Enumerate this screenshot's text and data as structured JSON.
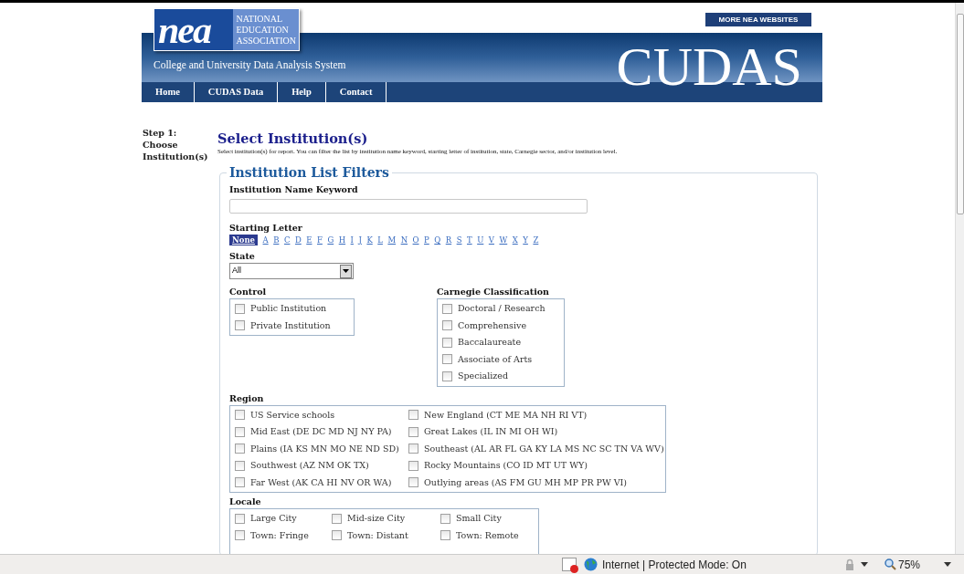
{
  "header": {
    "logo_mark": "nea",
    "logo_lines": [
      "NATIONAL",
      "EDUCATION",
      "ASSOCIATION"
    ],
    "more_link": "MORE NEA WEBSITES",
    "tagline": "College and University Data Analysis System",
    "brand": "CUDAS"
  },
  "nav": [
    {
      "label": "Home"
    },
    {
      "label": "CUDAS Data"
    },
    {
      "label": "Help"
    },
    {
      "label": "Contact"
    }
  ],
  "step": "Step 1: Choose Institution(s)",
  "title": "Select Institution(s)",
  "description": "Select institution(s) for report. You can filter the list by institution name keyword, starting letter of institution, state, Carnegie sector, and/or institution level.",
  "filters": {
    "legend": "Institution List Filters",
    "keyword": {
      "label": "Institution Name Keyword"
    },
    "starting_letter": {
      "label": "Starting Letter",
      "letters": [
        {
          "label": "None",
          "selected": true
        },
        {
          "label": "A",
          "selected": false
        },
        {
          "label": "B",
          "selected": false
        },
        {
          "label": "C",
          "selected": false
        },
        {
          "label": "D",
          "selected": false
        },
        {
          "label": "E",
          "selected": false
        },
        {
          "label": "F",
          "selected": false
        },
        {
          "label": "G",
          "selected": false
        },
        {
          "label": "H",
          "selected": false
        },
        {
          "label": "I",
          "selected": false
        },
        {
          "label": "J",
          "selected": false
        },
        {
          "label": "K",
          "selected": false
        },
        {
          "label": "L",
          "selected": false
        },
        {
          "label": "M",
          "selected": false
        },
        {
          "label": "N",
          "selected": false
        },
        {
          "label": "O",
          "selected": false
        },
        {
          "label": "P",
          "selected": false
        },
        {
          "label": "Q",
          "selected": false
        },
        {
          "label": "R",
          "selected": false
        },
        {
          "label": "S",
          "selected": false
        },
        {
          "label": "T",
          "selected": false
        },
        {
          "label": "U",
          "selected": false
        },
        {
          "label": "V",
          "selected": false
        },
        {
          "label": "W",
          "selected": false
        },
        {
          "label": "X",
          "selected": false
        },
        {
          "label": "Y",
          "selected": false
        },
        {
          "label": "Z",
          "selected": false
        }
      ]
    },
    "state": {
      "label": "State",
      "value": "All"
    },
    "control": {
      "label": "Control",
      "options": [
        {
          "label": "Public Institution",
          "checked": false
        },
        {
          "label": "Private Institution",
          "checked": false
        }
      ]
    },
    "carnegie": {
      "label": "Carnegie Classification",
      "options": [
        {
          "label": "Doctoral / Research",
          "checked": false
        },
        {
          "label": "Comprehensive",
          "checked": false
        },
        {
          "label": "Baccalaureate",
          "checked": false
        },
        {
          "label": "Associate of Arts",
          "checked": false
        },
        {
          "label": "Specialized",
          "checked": false
        }
      ]
    },
    "region": {
      "label": "Region",
      "options": [
        {
          "label": "US Service schools",
          "checked": false
        },
        {
          "label": "New England (CT ME MA NH RI VT)",
          "checked": false
        },
        {
          "label": "Mid East (DE DC MD NJ NY PA)",
          "checked": false
        },
        {
          "label": "Great Lakes (IL IN MI OH WI)",
          "checked": false
        },
        {
          "label": "Plains (IA KS MN MO NE ND SD)",
          "checked": false
        },
        {
          "label": "Southeast (AL AR FL GA KY LA MS NC SC TN VA WV)",
          "checked": false
        },
        {
          "label": "Southwest (AZ NM OK TX)",
          "checked": false
        },
        {
          "label": "Rocky Mountains (CO ID MT UT WY)",
          "checked": false
        },
        {
          "label": "Far West (AK CA HI NV OR WA)",
          "checked": false
        },
        {
          "label": "Outlying areas (AS FM GU MH MP PR PW VI)",
          "checked": false
        }
      ]
    },
    "locale": {
      "label": "Locale",
      "options": [
        {
          "label": "Large City",
          "checked": false
        },
        {
          "label": "Mid-size City",
          "checked": false
        },
        {
          "label": "Small City",
          "checked": false
        },
        {
          "label": "Town: Fringe",
          "checked": false
        },
        {
          "label": "Town: Distant",
          "checked": false
        },
        {
          "label": "Town: Remote",
          "checked": false
        }
      ]
    }
  },
  "status_bar": {
    "zone": "Internet | Protected Mode: On",
    "zoom": "75%"
  }
}
